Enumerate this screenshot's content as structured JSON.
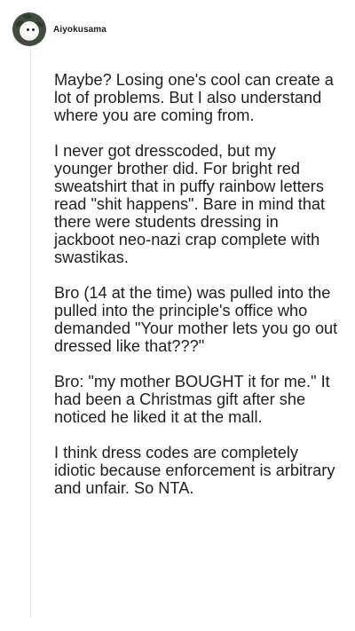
{
  "comment": {
    "username": "Aiyokusama",
    "paragraphs": [
      "Maybe? Losing one's cool can create a lot of problems. But I also understand where you are coming from.",
      "I never got dresscoded, but my younger brother did. For bright red sweatshirt that in puffy rainbow letters read \"shit happens\". Bare in mind that there were students dressing in jackboot neo-nazi crap complete with swastikas.",
      "Bro (14 at the time) was pulled into the pulled into the principle's office who demanded \"Your mother lets you go out dressed like that???\"",
      "Bro: \"my mother BOUGHT it for me.\" It had been a Christmas gift after she noticed he liked it at the mall.",
      "I think dress codes are completely idiotic because enforcement is arbitrary and unfair. So NTA."
    ]
  },
  "icons": {
    "avatar": "avatar-icon"
  },
  "colors": {
    "text": "#1f1f1f",
    "thread_line": "#e4e4e4",
    "background": "#ffffff"
  }
}
